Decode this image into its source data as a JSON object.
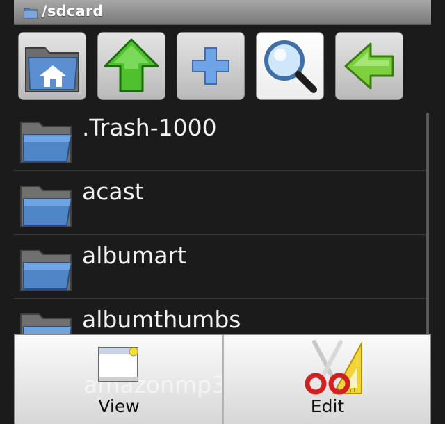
{
  "titlebar": {
    "path": "/sdcard",
    "icon": "folder-icon"
  },
  "toolbar": {
    "buttons": [
      {
        "name": "home-button",
        "icon": "home-folder-icon"
      },
      {
        "name": "up-button",
        "icon": "arrow-up-icon"
      },
      {
        "name": "new-folder-button",
        "icon": "plus-icon"
      },
      {
        "name": "search-button",
        "icon": "magnifier-icon"
      },
      {
        "name": "back-button",
        "icon": "arrow-left-icon"
      }
    ]
  },
  "files": [
    {
      "name": ".Trash-1000",
      "icon": "folder-icon"
    },
    {
      "name": "acast",
      "icon": "folder-icon"
    },
    {
      "name": "albumart",
      "icon": "folder-icon"
    },
    {
      "name": "albumthumbs",
      "icon": "folder-icon"
    },
    {
      "name": "amazonmp3",
      "icon": "folder-icon"
    }
  ],
  "menu": {
    "view_label": "View",
    "edit_label": "Edit",
    "view_icon": "window-icon",
    "edit_icon": "scissors-ruler-icon"
  },
  "colors": {
    "background": "#1b1b1b",
    "titlebar": "#8f8f8f",
    "folder_blue": "#4f86c8",
    "arrow_green": "#46b52a"
  }
}
